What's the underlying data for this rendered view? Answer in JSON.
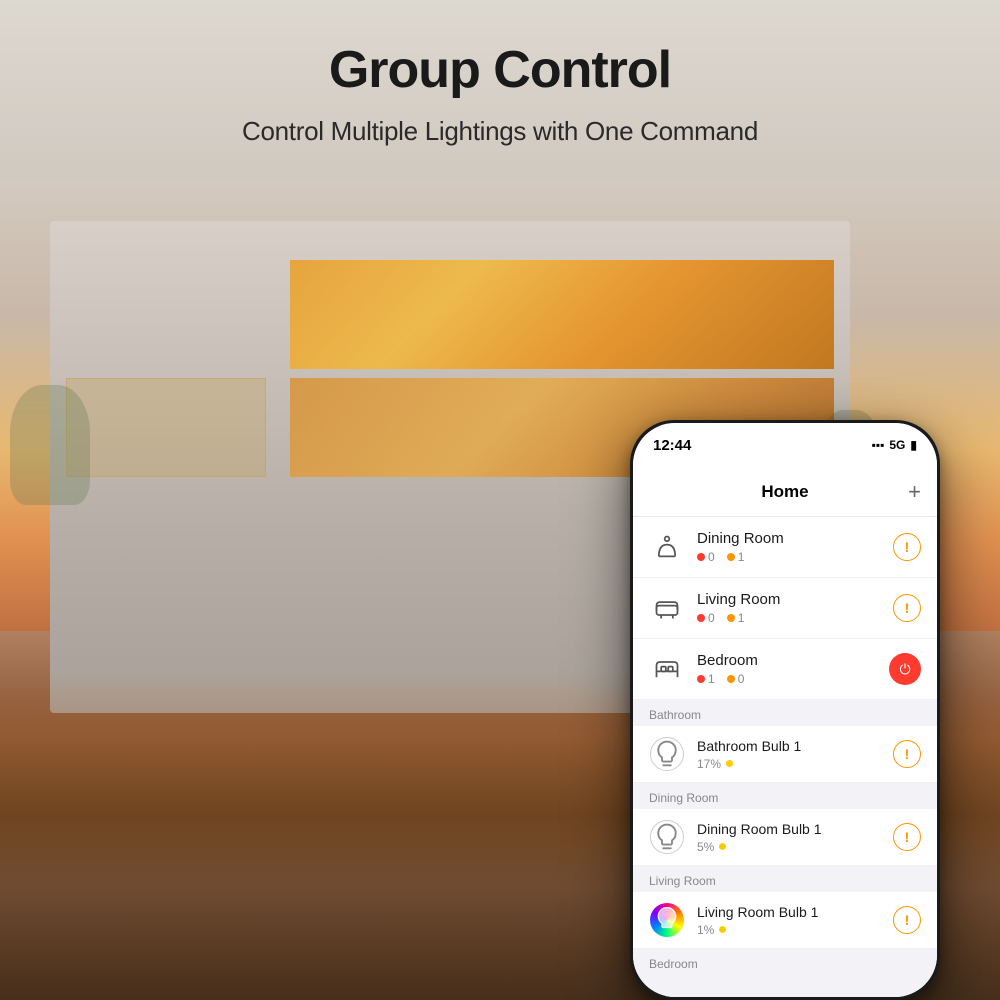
{
  "header": {
    "title": "Group Control",
    "subtitle": "Control Multiple Lightings with One Command"
  },
  "phone": {
    "status_bar": {
      "time": "12:44",
      "signal": "▪▪▪",
      "network": "5G",
      "battery": "🔋"
    },
    "app_title": "Home",
    "add_button": "+",
    "rooms": [
      {
        "name": "Dining Room",
        "icon": "dining-icon",
        "stat_red": "0",
        "stat_orange": "1",
        "action": "alert"
      },
      {
        "name": "Living Room",
        "icon": "living-icon",
        "stat_red": "0",
        "stat_orange": "1",
        "action": "alert"
      },
      {
        "name": "Bedroom",
        "icon": "bedroom-icon",
        "stat_red": "1",
        "stat_orange": "0",
        "action": "power"
      }
    ],
    "sections": [
      {
        "label": "Bathroom",
        "devices": [
          {
            "name": "Bathroom Bulb 1",
            "percent": "17%",
            "dot_color": "yellow",
            "icon": "bulb-icon",
            "action": "alert"
          }
        ]
      },
      {
        "label": "Dining Room",
        "devices": [
          {
            "name": "Dining Room Bulb 1",
            "percent": "5%",
            "dot_color": "yellow",
            "icon": "bulb-icon",
            "action": "alert"
          }
        ]
      },
      {
        "label": "Living Room",
        "devices": [
          {
            "name": "Living Room Bulb 1",
            "percent": "1%",
            "dot_color": "yellow",
            "icon": "bulb-color-icon",
            "action": "alert"
          }
        ]
      },
      {
        "label": "Bedroom",
        "devices": []
      }
    ]
  }
}
